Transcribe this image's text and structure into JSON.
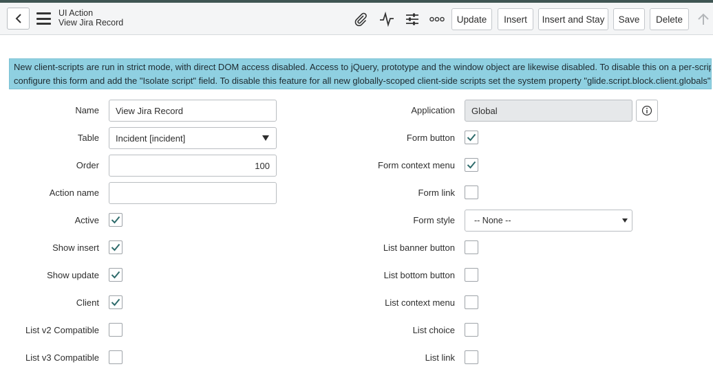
{
  "header": {
    "record_type": "UI Action",
    "record_name": "View Jira Record",
    "buttons": {
      "update": "Update",
      "insert": "Insert",
      "insert_and_stay": "Insert and Stay",
      "save": "Save",
      "delete": "Delete"
    },
    "icons": [
      "back-icon",
      "menu-icon",
      "paperclip-icon",
      "activity-icon",
      "personalize-icon",
      "more-options-icon",
      "scroll-up-icon"
    ]
  },
  "banner": {
    "line1": "New client-scripts are run in strict mode, with direct DOM access disabled. Access to jQuery, prototype and the window object are likewise disabled. To disable this on a per-script basis,",
    "line2": "configure this form and add the \"Isolate script\" field. To disable this feature for all new globally-scoped client-side scripts set the system property \"glide.script.block.client.globals\" to false."
  },
  "form": {
    "name": {
      "label": "Name",
      "value": "View Jira Record"
    },
    "table": {
      "label": "Table",
      "value": "Incident [incident]"
    },
    "order": {
      "label": "Order",
      "value": "100"
    },
    "action_name": {
      "label": "Action name",
      "value": ""
    },
    "active": {
      "label": "Active",
      "checked": true
    },
    "show_insert": {
      "label": "Show insert",
      "checked": true
    },
    "show_update": {
      "label": "Show update",
      "checked": true
    },
    "client": {
      "label": "Client",
      "checked": true
    },
    "list_v2": {
      "label": "List v2 Compatible",
      "checked": false
    },
    "list_v3": {
      "label": "List v3 Compatible",
      "checked": false
    },
    "application": {
      "label": "Application",
      "value": "Global"
    },
    "form_button": {
      "label": "Form button",
      "checked": true
    },
    "form_context_menu": {
      "label": "Form context menu",
      "checked": true
    },
    "form_link": {
      "label": "Form link",
      "checked": false
    },
    "form_style": {
      "label": "Form style",
      "value": "-- None --"
    },
    "list_banner_button": {
      "label": "List banner button",
      "checked": false
    },
    "list_bottom_button": {
      "label": "List bottom button",
      "checked": false
    },
    "list_context_menu": {
      "label": "List context menu",
      "checked": false
    },
    "list_choice": {
      "label": "List choice",
      "checked": false
    },
    "list_link": {
      "label": "List link",
      "checked": false
    }
  },
  "colors": {
    "top_stripe": "#3f5553",
    "banner_bg": "#8fd0e1",
    "checkmark": "#2e6b6b",
    "readonly_bg": "#e6e8ea"
  }
}
